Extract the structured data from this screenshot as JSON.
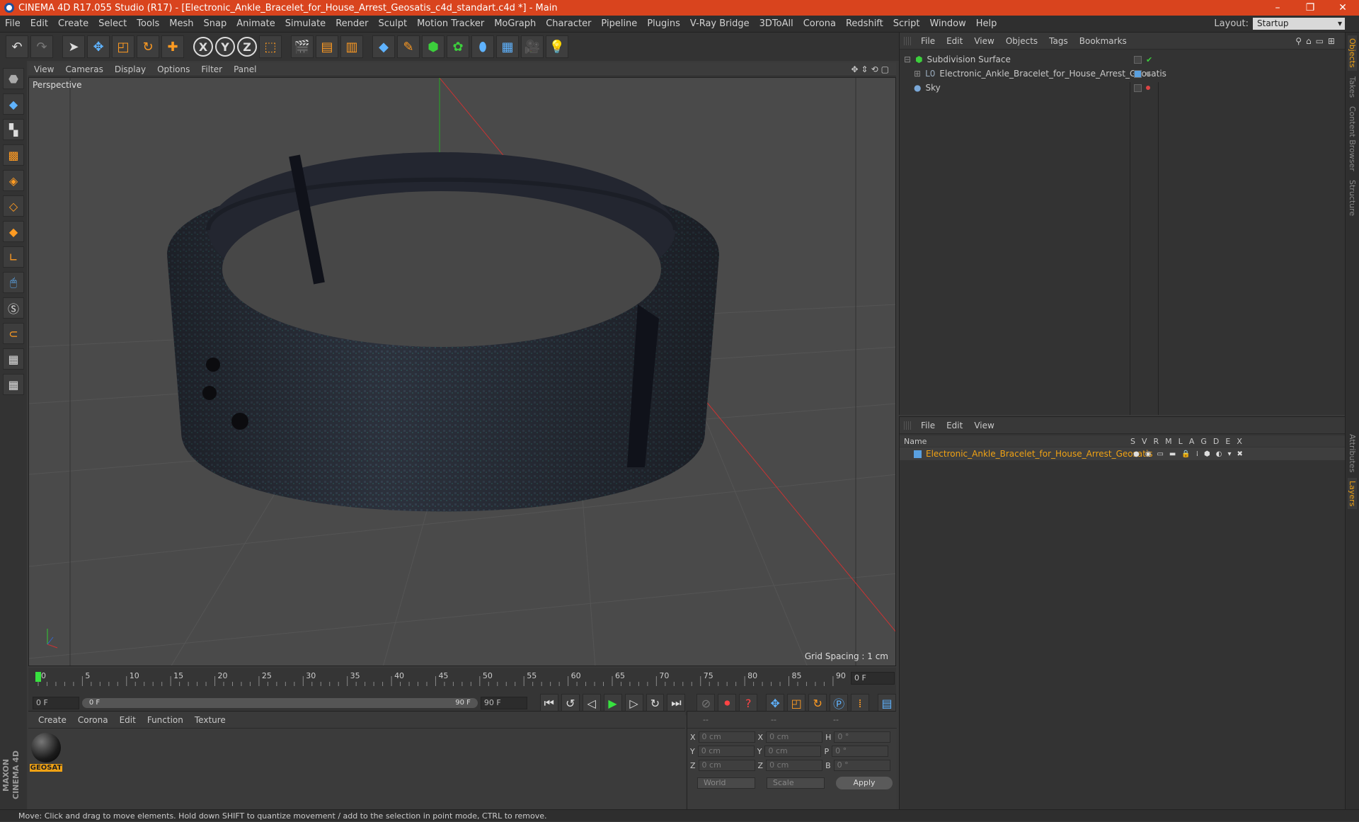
{
  "window": {
    "title": "CINEMA 4D R17.055 Studio (R17) - [Electronic_Ankle_Bracelet_for_House_Arrest_Geosatis_c4d_standart.c4d *] - Main",
    "controls": [
      "–",
      "❐",
      "✕"
    ]
  },
  "menubar": {
    "items": [
      "File",
      "Edit",
      "Create",
      "Select",
      "Tools",
      "Mesh",
      "Snap",
      "Animate",
      "Simulate",
      "Render",
      "Sculpt",
      "Motion Tracker",
      "MoGraph",
      "Character",
      "Pipeline",
      "Plugins",
      "V-Ray Bridge",
      "3DToAll",
      "Corona",
      "Redshift",
      "Script",
      "Window",
      "Help"
    ],
    "layout_label": "Layout:",
    "layout_value": "Startup"
  },
  "toolbar": {
    "axis_x": "X",
    "axis_y": "Y",
    "axis_z": "Z"
  },
  "viewport": {
    "menu": [
      "View",
      "Cameras",
      "Display",
      "Options",
      "Filter",
      "Panel"
    ],
    "label": "Perspective",
    "grid_spacing": "Grid Spacing : 1 cm"
  },
  "timeline": {
    "ticks": [
      "0",
      "5",
      "10",
      "15",
      "20",
      "25",
      "30",
      "35",
      "40",
      "45",
      "50",
      "55",
      "60",
      "65",
      "70",
      "75",
      "80",
      "85",
      "90"
    ],
    "current_frame": "0 F"
  },
  "transport": {
    "start_field": "0 F",
    "slider_start": "0 F",
    "slider_end": "90 F",
    "end_field": "90 F"
  },
  "material_panel": {
    "menu": [
      "Create",
      "Corona",
      "Edit",
      "Function",
      "Texture"
    ],
    "material_name": "GEOSAT"
  },
  "coord_panel": {
    "header": [
      "--",
      "--",
      "--"
    ],
    "rows": [
      {
        "a": "X",
        "av": "0 cm",
        "b": "X",
        "bv": "0 cm",
        "c": "H",
        "cv": "0 °"
      },
      {
        "a": "Y",
        "av": "0 cm",
        "b": "Y",
        "bv": "0 cm",
        "c": "P",
        "cv": "0 °"
      },
      {
        "a": "Z",
        "av": "0 cm",
        "b": "Z",
        "bv": "0 cm",
        "c": "B",
        "cv": "0 °"
      }
    ],
    "world": "World",
    "scale": "Scale",
    "apply": "Apply"
  },
  "object_manager": {
    "menu": [
      "File",
      "Edit",
      "View",
      "Objects",
      "Tags",
      "Bookmarks"
    ],
    "objects": [
      {
        "name": "Subdivision Surface",
        "color": "#3ccf3c"
      },
      {
        "name": "Electronic_Ankle_Bracelet_for_House_Arrest_Geosatis",
        "color": "#9ab"
      },
      {
        "name": "Sky",
        "color": "#7aa8d8"
      }
    ]
  },
  "layer_manager": {
    "menu": [
      "File",
      "Edit",
      "View"
    ],
    "header_name": "Name",
    "columns": [
      "S",
      "V",
      "R",
      "M",
      "L",
      "A",
      "G",
      "D",
      "E",
      "X"
    ],
    "layers": [
      {
        "name": "Electronic_Ankle_Bracelet_for_House_Arrest_Geosatis",
        "color": "#5aa0e0"
      }
    ]
  },
  "right_tabs": [
    "Objects",
    "Takes",
    "Content Browser",
    "Structure",
    "Attributes",
    "Layers"
  ],
  "statusbar": "Move: Click and drag to move elements. Hold down SHIFT to quantize movement / add to the selection in point mode, CTRL to remove."
}
